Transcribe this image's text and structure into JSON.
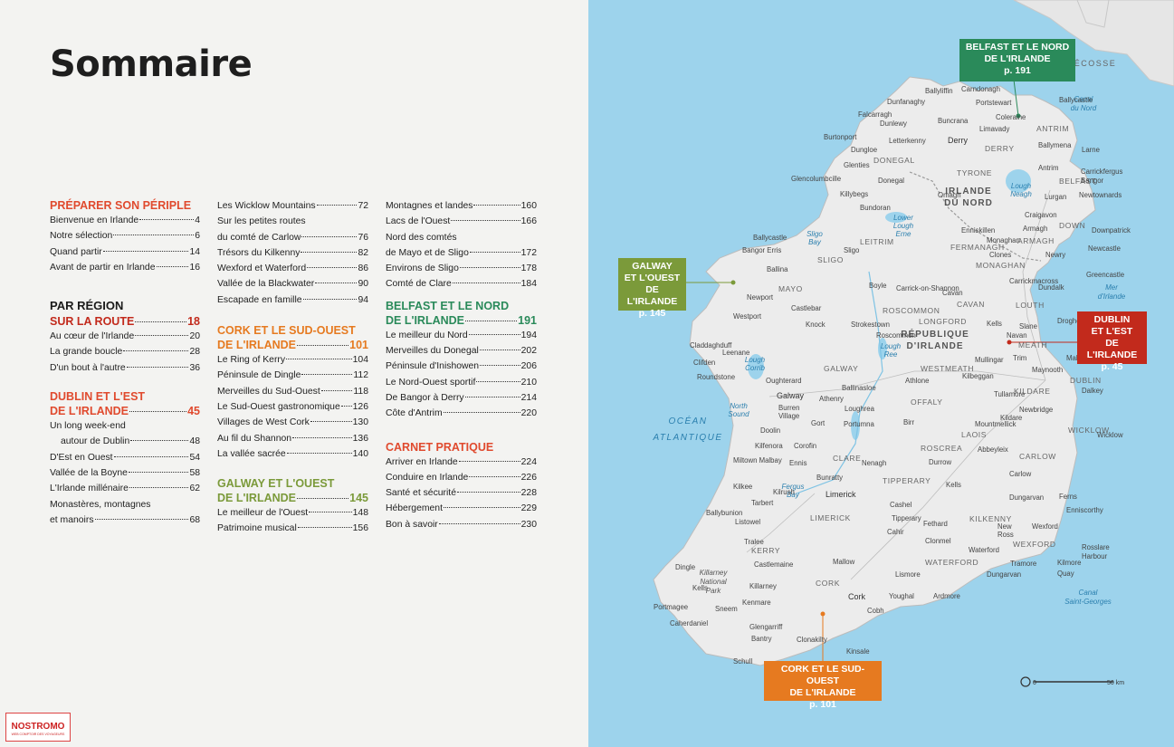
{
  "title": "Sommaire",
  "logo": {
    "name": "NOSTROMO",
    "tagline": "WEB COMPTOIR DES VOYAGEURS"
  },
  "colors": {
    "red": "#e04a2e",
    "orange": "#e67a20",
    "green": "#7b9a3a",
    "teal": "#2a8a5a",
    "dark_red": "#c22a1c",
    "sea": "#9dd3ec",
    "land": "#ececec"
  },
  "toc": {
    "col1": {
      "preparer": {
        "title": "PRÉPARER SON PÉRIPLE",
        "items": [
          {
            "label": "Bienvenue en Irlande",
            "page": "4"
          },
          {
            "label": "Notre sélection",
            "page": "6"
          },
          {
            "label": "Quand partir",
            "page": "14"
          },
          {
            "label": "Avant de partir en Irlande",
            "page": "16"
          }
        ]
      },
      "par_region": "PAR RÉGION",
      "route": {
        "title": "SUR LA ROUTE",
        "page": "18",
        "items": [
          {
            "label": "Au cœur de l'Irlande",
            "page": "20"
          },
          {
            "label": "La grande boucle",
            "page": "28"
          },
          {
            "label": "D'un bout à l'autre",
            "page": "36"
          }
        ]
      },
      "dublin": {
        "title1": "DUBLIN ET L'EST",
        "title2": "DE L'IRLANDE",
        "page": "45",
        "week1": "Un long week-end",
        "week2": "autour de Dublin",
        "week_page": "48",
        "items": [
          {
            "label": "D'Est en Ouest",
            "page": "54"
          },
          {
            "label": "Vallée de la Boyne",
            "page": "58"
          },
          {
            "label": "L'Irlande millénaire",
            "page": "62"
          }
        ],
        "mon1": "Monastères, montagnes",
        "mon2": "et manoirs",
        "mon_page": "68"
      }
    },
    "col2": {
      "items_a": [
        {
          "label": "Les Wicklow Mountains",
          "page": "72"
        }
      ],
      "carlow1": "Sur les petites routes",
      "carlow2": "du comté de Carlow",
      "carlow_page": "76",
      "items_b": [
        {
          "label": "Trésors du Kilkenny",
          "page": "82"
        },
        {
          "label": "Wexford et Waterford",
          "page": "86"
        },
        {
          "label": "Vallée de la Blackwater",
          "page": "90"
        },
        {
          "label": "Escapade en famille",
          "page": "94"
        }
      ],
      "cork": {
        "title1": "CORK ET LE SUD-OUEST",
        "title2": "DE L'IRLANDE",
        "page": "101",
        "items": [
          {
            "label": "Le Ring of Kerry",
            "page": "104"
          },
          {
            "label": "Péninsule de Dingle",
            "page": "112"
          },
          {
            "label": "Merveilles du Sud-Ouest",
            "page": "118"
          },
          {
            "label": "Le Sud-Ouest gastronomique",
            "page": "126"
          },
          {
            "label": "Villages de West Cork",
            "page": "130"
          },
          {
            "label": "Au fil du Shannon",
            "page": "136"
          },
          {
            "label": "La vallée sacrée",
            "page": "140"
          }
        ]
      },
      "galway": {
        "title1": "GALWAY ET L'OUEST",
        "title2": "DE L'IRLANDE",
        "page": "145",
        "items": [
          {
            "label": "Le meilleur de l'Ouest",
            "page": "148"
          },
          {
            "label": "Patrimoine musical",
            "page": "156"
          }
        ]
      }
    },
    "col3": {
      "items_a": [
        {
          "label": "Montagnes et landes",
          "page": "160"
        },
        {
          "label": "Lacs de l'Ouest",
          "page": "166"
        }
      ],
      "mayo1": "Nord des comtés",
      "mayo2": "de Mayo et de Sligo",
      "mayo_page": "172",
      "items_b": [
        {
          "label": "Environs de Sligo",
          "page": "178"
        },
        {
          "label": "Comté de Clare",
          "page": "184"
        }
      ],
      "belfast": {
        "title1": "BELFAST ET LE NORD",
        "title2": "DE L'IRLANDE",
        "page": "191",
        "items": [
          {
            "label": "Le meilleur du Nord",
            "page": "194"
          },
          {
            "label": "Merveilles du Donegal",
            "page": "202"
          },
          {
            "label": "Péninsule d'Inishowen",
            "page": "206"
          },
          {
            "label": "Le Nord-Ouest sportif",
            "page": "210"
          },
          {
            "label": "De Bangor à Derry",
            "page": "214"
          },
          {
            "label": "Côte d'Antrim",
            "page": "220"
          }
        ]
      },
      "carnet": {
        "title": "CARNET PRATIQUE",
        "items": [
          {
            "label": "Arriver en Irlande",
            "page": "224"
          },
          {
            "label": "Conduire en Irlande",
            "page": "226"
          },
          {
            "label": "Santé et sécurité",
            "page": "228"
          },
          {
            "label": "Hébergement",
            "page": "229"
          },
          {
            "label": "Bon à savoir",
            "page": "230"
          }
        ]
      }
    }
  },
  "map": {
    "callouts": {
      "belfast": {
        "l1": "BELFAST ET LE NORD",
        "l2": "DE L'IRLANDE",
        "l3": "p. 191"
      },
      "galway": {
        "l1": "GALWAY",
        "l2": "ET L'OUEST",
        "l3": "DE L'IRLANDE",
        "l4": "p. 145"
      },
      "dublin": {
        "l1": "DUBLIN",
        "l2": "ET L'EST",
        "l3": "DE L'IRLANDE",
        "l4": "p. 45"
      },
      "cork": {
        "l1": "CORK ET LE SUD-OUEST",
        "l2": "DE L'IRLANDE",
        "l3": "p. 101"
      }
    },
    "scale": {
      "start": "0",
      "end": "50 km"
    },
    "sea_labels": {
      "ecosse": "ÉCOSSE",
      "canal_nord_1": "Canal",
      "canal_nord_2": "du Nord",
      "mer_1": "Mer",
      "mer_2": "d'Irlande",
      "ocean_1": "OCÉAN",
      "ocean_2": "ATLANTIQUE",
      "canal_sg_1": "Canal",
      "canal_sg_2": "Saint-Georges",
      "sligo_bay_1": "Sligo",
      "sligo_bay_2": "Bay",
      "north_sound_1": "North",
      "north_sound_2": "Sound",
      "fergus_1": "Fergus",
      "fergus_2": "Bay",
      "lough_corrib_1": "Lough",
      "lough_corrib_2": "Corrib",
      "lough_neagh_1": "Lough",
      "lough_neagh_2": "Neagh",
      "lower_erne_1": "Lower",
      "lower_erne_2": "Lough",
      "lower_erne_3": "Erne",
      "lough_ree_1": "Lough",
      "lough_ree_2": "Ree"
    },
    "regions": {
      "irlande_nord_1": "IRLANDE",
      "irlande_nord_2": "DU NORD",
      "republique_1": "RÉPUBLIQUE",
      "republique_2": "D'IRLANDE",
      "killarney_1": "Killarney",
      "killarney_2": "National",
      "killarney_3": "Park"
    },
    "places": {
      "p01": "Ballyliffin",
      "p02": "Carndonagh",
      "p03": "Dunfanaghy",
      "p04": "Portstewart",
      "p05": "Ballycastle",
      "p06": "Falcarragh",
      "p07": "Dunlewy",
      "p08": "Buncrana",
      "p09": "Coleraine",
      "p10": "Burtonport",
      "p11": "Letterkenny",
      "p12": "Limavady",
      "p13": "ANTRIM",
      "p14": "Derry",
      "p15": "Dungloe",
      "p16": "DERRY",
      "p17": "Ballymena",
      "p18": "Larne",
      "p19": "DONEGAL",
      "p20": "Glenties",
      "p21": "Antrim",
      "p22": "Carrickfergus",
      "p23": "Glencolumbcille",
      "p24": "TYRONE",
      "p25": "Donegal",
      "p26": "BELFAST",
      "p27": "Bangor",
      "p28": "Omagh",
      "p29": "Newtownards",
      "p30": "Killybegs",
      "p31": "Bundoran",
      "p32": "Lurgan",
      "p33": "Craigavon",
      "p34": "DOWN",
      "p35": "Ballycastle",
      "p36": "Enniskillen",
      "p37": "Armagh",
      "p38": "Downpatrick",
      "p39": "SLIGO",
      "p40": "LEITRIM",
      "p41": "Monaghan",
      "p42": "ARMAGH",
      "p43": "Bangor Erris",
      "p44": "FERMANAGH",
      "p45": "Newcastle",
      "p46": "Sligo",
      "p47": "Clones",
      "p48": "Newry",
      "p49": "Ballina",
      "p50": "MONAGHAN",
      "p51": "Greencastle",
      "p52": "MAYO",
      "p53": "Boyle",
      "p54": "Carrick-on-Shannon",
      "p55": "Carrickmacross",
      "p56": "Cavan",
      "p57": "Dundalk",
      "p58": "Newport",
      "p59": "CAVAN",
      "p60": "ROSCOMMON",
      "p61": "Castlebar",
      "p62": "LOUTH",
      "p63": "Westport",
      "p64": "Knock",
      "p65": "Strokestown",
      "p66": "LONGFORD",
      "p67": "Kells",
      "p68": "Drogheda",
      "p69": "Slane",
      "p70": "Roscommon",
      "p71": "Navan",
      "p72": "Claddaghduff",
      "p73": "Leenane",
      "p74": "MEATH",
      "p75": "Trim",
      "p76": "Clifden",
      "p77": "Mullingar",
      "p78": "Malahide",
      "p79": "WESTMEATH",
      "p80": "Maynooth",
      "p81": "Roundstone",
      "p82": "Oughterard",
      "p83": "GALWAY",
      "p84": "Kilbeggan",
      "p85": "Athlone",
      "p86": "DUBLIN",
      "p87": "Ballinasloe",
      "p88": "Dalkey",
      "p89": "Tullamore",
      "p90": "KILDARE",
      "p91": "Galway",
      "p92": "Athenry",
      "p93": "OFFALY",
      "p94": "Newbridge",
      "p95": "Burren",
      "p96": "Village",
      "p97": "Loughrea",
      "p98": "Kildare",
      "p99": "Gort",
      "p100": "Birr",
      "p101": "Portumna",
      "p102": "Mountmellick",
      "p103": "Doolin",
      "p104": "WICKLOW",
      "p105": "LAOIS",
      "p106": "Kilfenora",
      "p107": "Corofin",
      "p108": "Abbeyleix",
      "p109": "Wicklow",
      "p110": "Miltown Malbay",
      "p111": "CLARE",
      "p112": "ROSCREA",
      "p113": "Durrow",
      "p114": "CARLOW",
      "p115": "Ennis",
      "p116": "Nenagh",
      "p117": "Bunratty",
      "p118": "Carlow",
      "p119": "Kilkee",
      "p120": "Kilrush",
      "p121": "TIPPERARY",
      "p122": "Kells",
      "p123": "Dungarvan",
      "p124": "Limerick",
      "p125": "Tarbert",
      "p126": "Cashel",
      "p127": "Ferns",
      "p128": "Ballybunion",
      "p129": "LIMERICK",
      "p130": "Tipperary",
      "p131": "KILKENNY",
      "p132": "Enniscorthy",
      "p133": "Listowel",
      "p134": "Cahir",
      "p135": "Fethard",
      "p136": "New",
      "p137": "Ross",
      "p138": "Wexford",
      "p139": "Tralee",
      "p140": "Clonmel",
      "p141": "WEXFORD",
      "p142": "KERRY",
      "p143": "Waterford",
      "p144": "Rosslare",
      "p145": "Harbour",
      "p146": "Castlemaine",
      "p147": "Mallow",
      "p148": "Dingle",
      "p149": "WATERFORD",
      "p150": "Tramore",
      "p151": "Kilmore",
      "p152": "Quay",
      "p153": "Dungarvan",
      "p154": "Lismore",
      "p155": "Killarney",
      "p156": "CORK",
      "p157": "Kells",
      "p158": "Portmagee",
      "p159": "Kenmare",
      "p160": "Cork",
      "p161": "Youghal",
      "p162": "Ardmore",
      "p163": "Sneem",
      "p164": "Cobh",
      "p165": "Caherdaniel",
      "p166": "Glengarriff",
      "p167": "Bantry",
      "p168": "Clonakilty",
      "p169": "Kinsale",
      "p170": "Schull"
    }
  }
}
